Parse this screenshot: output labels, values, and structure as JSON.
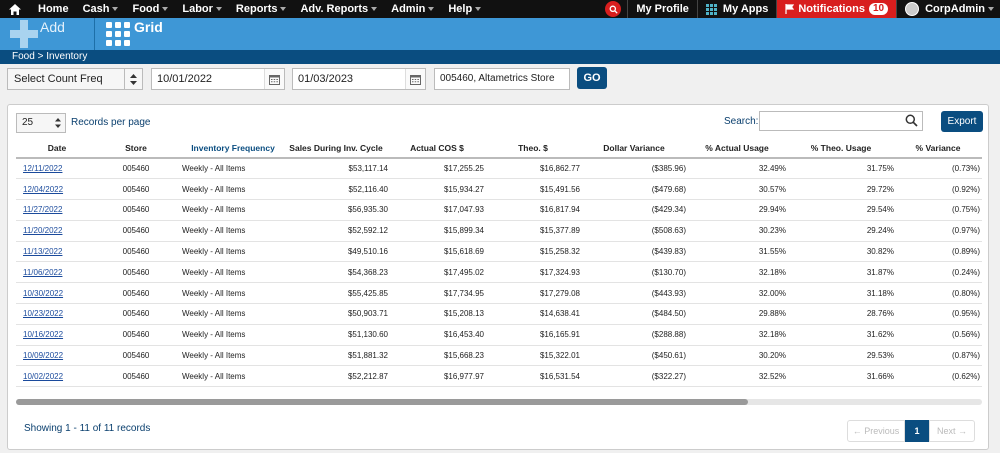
{
  "nav": {
    "items": [
      "Home",
      "Cash",
      "Food",
      "Labor",
      "Reports",
      "Adv. Reports",
      "Admin",
      "Help"
    ],
    "my_profile": "My Profile",
    "my_apps": "My Apps",
    "notifications": "Notifications",
    "notification_count": "10",
    "user": "CorpAdmin"
  },
  "toolbar": {
    "add_label": "Add",
    "grid_label": "Grid"
  },
  "breadcrumb": {
    "text": "Food  >  Inventory"
  },
  "filters": {
    "count_freq": "Select Count Freq",
    "start_date": "10/01/2022",
    "end_date": "01/03/2023",
    "store": "005460, Altametrics Store",
    "go_label": "GO"
  },
  "grid": {
    "page_size": "25",
    "records_per_page_label": "Records per page",
    "search_label": "Search:",
    "search_value": "",
    "export_label": "Export",
    "columns": [
      "Date",
      "Store",
      "Inventory Frequency",
      "Sales During Inv. Cycle",
      "Actual COS $",
      "Theo. $",
      "Dollar Variance",
      "% Actual Usage",
      "% Theo. Usage",
      "% Variance"
    ],
    "rows": [
      [
        "12/11/2022",
        "005460",
        "Weekly - All Items",
        "$53,117.14",
        "$17,255.25",
        "$16,862.77",
        "($385.96)",
        "32.49%",
        "31.75%",
        "(0.73%)"
      ],
      [
        "12/04/2022",
        "005460",
        "Weekly - All Items",
        "$52,116.40",
        "$15,934.27",
        "$15,491.56",
        "($479.68)",
        "30.57%",
        "29.72%",
        "(0.92%)"
      ],
      [
        "11/27/2022",
        "005460",
        "Weekly - All Items",
        "$56,935.30",
        "$17,047.93",
        "$16,817.94",
        "($429.34)",
        "29.94%",
        "29.54%",
        "(0.75%)"
      ],
      [
        "11/20/2022",
        "005460",
        "Weekly - All Items",
        "$52,592.12",
        "$15,899.34",
        "$15,377.89",
        "($508.63)",
        "30.23%",
        "29.24%",
        "(0.97%)"
      ],
      [
        "11/13/2022",
        "005460",
        "Weekly - All Items",
        "$49,510.16",
        "$15,618.69",
        "$15,258.32",
        "($439.83)",
        "31.55%",
        "30.82%",
        "(0.89%)"
      ],
      [
        "11/06/2022",
        "005460",
        "Weekly - All Items",
        "$54,368.23",
        "$17,495.02",
        "$17,324.93",
        "($130.70)",
        "32.18%",
        "31.87%",
        "(0.24%)"
      ],
      [
        "10/30/2022",
        "005460",
        "Weekly - All Items",
        "$55,425.85",
        "$17,734.95",
        "$17,279.08",
        "($443.93)",
        "32.00%",
        "31.18%",
        "(0.80%)"
      ],
      [
        "10/23/2022",
        "005460",
        "Weekly - All Items",
        "$50,903.71",
        "$15,208.13",
        "$14,638.41",
        "($484.50)",
        "29.88%",
        "28.76%",
        "(0.95%)"
      ],
      [
        "10/16/2022",
        "005460",
        "Weekly - All Items",
        "$51,130.60",
        "$16,453.40",
        "$16,165.91",
        "($288.88)",
        "32.18%",
        "31.62%",
        "(0.56%)"
      ],
      [
        "10/09/2022",
        "005460",
        "Weekly - All Items",
        "$51,881.32",
        "$15,668.23",
        "$15,322.01",
        "($450.61)",
        "30.20%",
        "29.53%",
        "(0.87%)"
      ],
      [
        "10/02/2022",
        "005460",
        "Weekly - All Items",
        "$52,212.87",
        "$16,977.97",
        "$16,531.54",
        "($322.27)",
        "32.52%",
        "31.66%",
        "(0.62%)"
      ]
    ],
    "showing": "Showing 1 - 11 of 11 records",
    "pager": {
      "prev": "← Previous",
      "current": "1",
      "next": "Next →"
    }
  },
  "colors": {
    "nav_bg": "#111111",
    "toolbar_blue": "#3e97d6",
    "dark_blue": "#0a4d80",
    "alert_red": "#d81e1e"
  }
}
